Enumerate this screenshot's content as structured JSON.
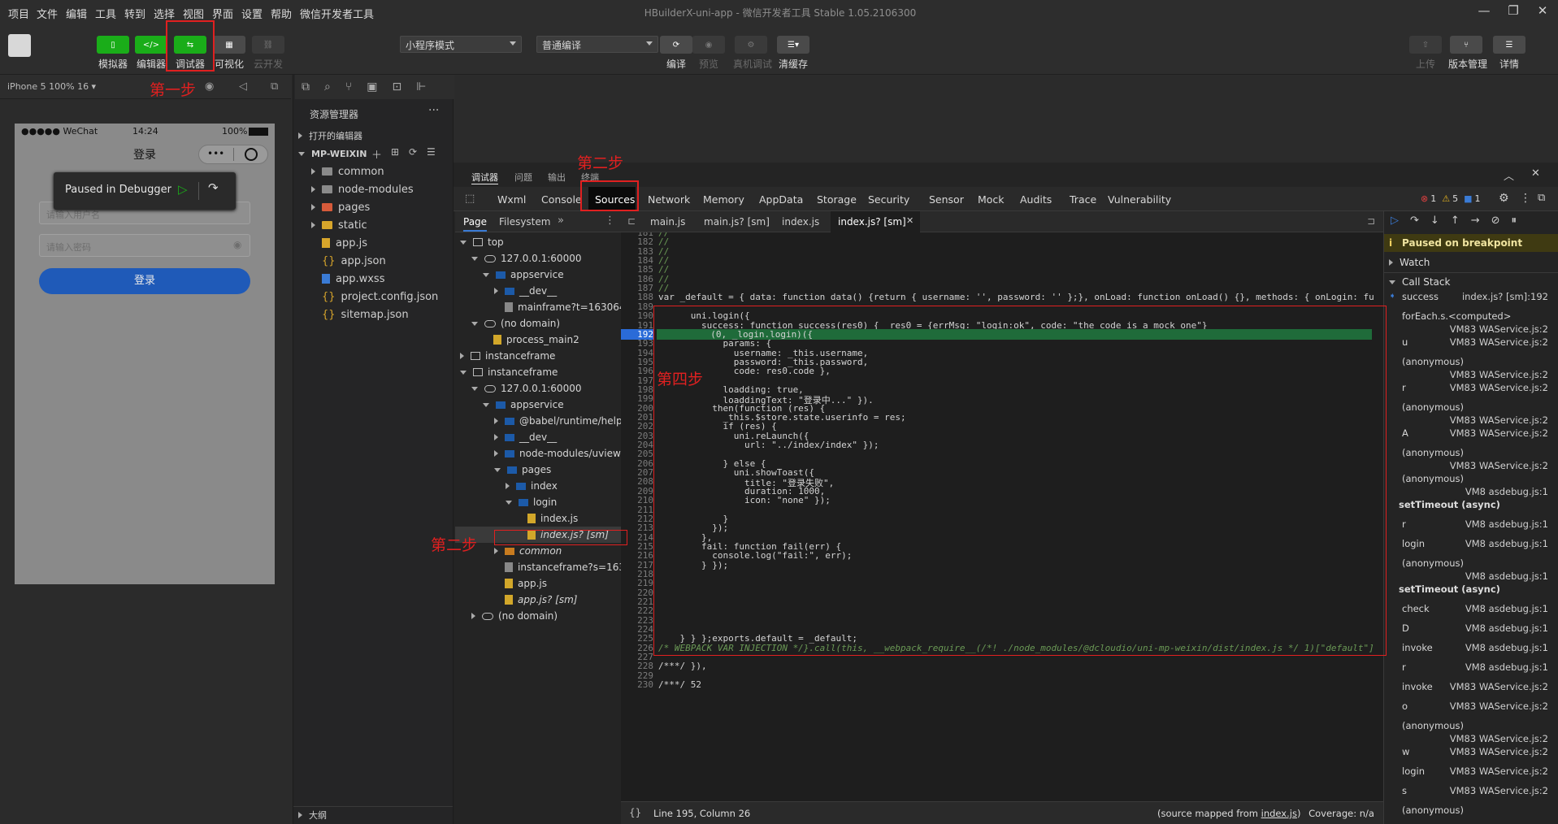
{
  "menu": [
    "项目",
    "文件",
    "编辑",
    "工具",
    "转到",
    "选择",
    "视图",
    "界面",
    "设置",
    "帮助",
    "微信开发者工具"
  ],
  "window_title": "HBuilderX-uni-app - 微信开发者工具 Stable 1.05.2106300",
  "toolbar": {
    "simulator": "模拟器",
    "editor": "编辑器",
    "debugger": "调试器",
    "visual": "可视化",
    "cloud": "云开发",
    "mode_select": "小程序模式",
    "compile_select": "普通编译",
    "compile": "编译",
    "preview": "预览",
    "remote_debug": "真机调试",
    "clear_cache": "清缓存",
    "upload": "上传",
    "version": "版本管理",
    "details": "详情"
  },
  "annotations": {
    "step1": "第一步",
    "step2a": "第二步",
    "step2b": "第二步",
    "step4": "第四步"
  },
  "device": {
    "info": "iPhone 5 100% 16 ▾",
    "carrier": "●●●●● WeChat",
    "time": "14:24",
    "battery": "100%",
    "page_title": "登录",
    "paused_text": "Paused in Debugger",
    "username_placeholder": "请输入用户名",
    "password_placeholder": "请输入密码",
    "login_button": "登录"
  },
  "explorer": {
    "title": "资源管理器",
    "open_editors": "打开的编辑器",
    "project": "MP-WEIXIN",
    "items": [
      "common",
      "node-modules",
      "pages",
      "static",
      "app.js",
      "app.json",
      "app.wxss",
      "project.config.json",
      "sitemap.json"
    ],
    "outline": "大纲"
  },
  "devtools": {
    "top_tabs": [
      "调试器",
      "问题",
      "输出",
      "终端"
    ],
    "tabs": [
      "Wxml",
      "Console",
      "Sources",
      "Network",
      "Memory",
      "AppData",
      "Storage",
      "Security",
      "Sensor",
      "Mock",
      "Audits",
      "Trace",
      "Vulnerability"
    ],
    "errors": "1",
    "warnings": "5",
    "infos": "1"
  },
  "sources": {
    "tabs": [
      "Page",
      "Filesystem"
    ],
    "tree": [
      {
        "label": "top",
        "depth": 0,
        "icon": "frame",
        "open": true
      },
      {
        "label": "127.0.0.1:60000",
        "depth": 1,
        "icon": "cloud",
        "open": true
      },
      {
        "label": "appservice",
        "depth": 2,
        "icon": "bfold",
        "open": true
      },
      {
        "label": "__dev__",
        "depth": 3,
        "icon": "bfold",
        "open": false
      },
      {
        "label": "mainframe?t=163064979",
        "depth": 3,
        "icon": "gfile",
        "open": null
      },
      {
        "label": "(no domain)",
        "depth": 1,
        "icon": "cloud",
        "open": true
      },
      {
        "label": "process_main2",
        "depth": 2,
        "icon": "yfile",
        "open": null
      },
      {
        "label": "instanceframe",
        "depth": 0,
        "icon": "frame",
        "open": false
      },
      {
        "label": "instanceframe",
        "depth": 0,
        "icon": "frame",
        "open": true
      },
      {
        "label": "127.0.0.1:60000",
        "depth": 1,
        "icon": "cloud",
        "open": true
      },
      {
        "label": "appservice",
        "depth": 2,
        "icon": "bfold",
        "open": true
      },
      {
        "label": "@babel/runtime/helpe",
        "depth": 3,
        "icon": "bfold",
        "open": false
      },
      {
        "label": "__dev__",
        "depth": 3,
        "icon": "bfold",
        "open": false
      },
      {
        "label": "node-modules/uview-",
        "depth": 3,
        "icon": "bfold",
        "open": false
      },
      {
        "label": "pages",
        "depth": 3,
        "icon": "bfold",
        "open": true
      },
      {
        "label": "index",
        "depth": 4,
        "icon": "bfold",
        "open": false
      },
      {
        "label": "login",
        "depth": 4,
        "icon": "bfold",
        "open": true
      },
      {
        "label": "index.js",
        "depth": 5,
        "icon": "yfile",
        "open": null
      },
      {
        "label": "index.js? [sm]",
        "depth": 5,
        "icon": "yfile",
        "open": null,
        "italic": true,
        "selected": true
      },
      {
        "label": "common",
        "depth": 3,
        "icon": "ofold",
        "open": false,
        "italic": true
      },
      {
        "label": "instanceframe?s=1630",
        "depth": 3,
        "icon": "gfile",
        "open": null
      },
      {
        "label": "app.js",
        "depth": 3,
        "icon": "yfile",
        "open": null
      },
      {
        "label": "app.js? [sm]",
        "depth": 3,
        "icon": "yfile",
        "open": null,
        "italic": true
      },
      {
        "label": "(no domain)",
        "depth": 1,
        "icon": "cloud",
        "open": false
      }
    ]
  },
  "editor": {
    "tabs": [
      "main.js",
      "main.js? [sm]",
      "index.js",
      "index.js? [sm]"
    ],
    "lines": [
      {
        "n": "181",
        "t": "//",
        "c": "cm"
      },
      {
        "n": "182",
        "t": "//",
        "c": "cm"
      },
      {
        "n": "183",
        "t": "//",
        "c": "cm"
      },
      {
        "n": "184",
        "t": "//",
        "c": "cm"
      },
      {
        "n": "185",
        "t": "//",
        "c": "cm"
      },
      {
        "n": "186",
        "t": "//",
        "c": "cm"
      },
      {
        "n": "187",
        "t": "//",
        "c": "cm"
      },
      {
        "n": "188",
        "t": "var _default = { data: function data() {return { username: '', password: '' };}, onLoad: function onLoad() {}, methods: { onLogin: fu",
        "c": ""
      },
      {
        "n": "189",
        "t": "",
        "c": ""
      },
      {
        "n": "190",
        "t": "      uni.login({",
        "c": ""
      },
      {
        "n": "191",
        "t": "        success: function success(res0) {  res0 = {errMsg: \"login:ok\", code: \"the code is a mock one\"}",
        "c": ""
      },
      {
        "n": "192",
        "t": "          (0, _login.login)({",
        "c": ""
      },
      {
        "n": "193",
        "t": "            params: {",
        "c": ""
      },
      {
        "n": "194",
        "t": "              username: _this.username,",
        "c": ""
      },
      {
        "n": "195",
        "t": "              password: _this.password,",
        "c": ""
      },
      {
        "n": "196",
        "t": "              code: res0.code },",
        "c": ""
      },
      {
        "n": "197",
        "t": "",
        "c": ""
      },
      {
        "n": "198",
        "t": "            loadding: true,",
        "c": ""
      },
      {
        "n": "199",
        "t": "            loaddingText: \"登录中...\" }).",
        "c": ""
      },
      {
        "n": "200",
        "t": "          then(function (res) {",
        "c": ""
      },
      {
        "n": "201",
        "t": "            _this.$store.state.userinfo = res;",
        "c": ""
      },
      {
        "n": "202",
        "t": "            if (res) {",
        "c": ""
      },
      {
        "n": "203",
        "t": "              uni.reLaunch({",
        "c": ""
      },
      {
        "n": "204",
        "t": "                url: \"../index/index\" });",
        "c": ""
      },
      {
        "n": "205",
        "t": "",
        "c": ""
      },
      {
        "n": "206",
        "t": "            } else {",
        "c": ""
      },
      {
        "n": "207",
        "t": "              uni.showToast({",
        "c": ""
      },
      {
        "n": "208",
        "t": "                title: \"登录失败\",",
        "c": ""
      },
      {
        "n": "209",
        "t": "                duration: 1000,",
        "c": ""
      },
      {
        "n": "210",
        "t": "                icon: \"none\" });",
        "c": ""
      },
      {
        "n": "211",
        "t": "",
        "c": ""
      },
      {
        "n": "212",
        "t": "            }",
        "c": ""
      },
      {
        "n": "213",
        "t": "          });",
        "c": ""
      },
      {
        "n": "214",
        "t": "        },",
        "c": ""
      },
      {
        "n": "215",
        "t": "        fail: function fail(err) {",
        "c": ""
      },
      {
        "n": "216",
        "t": "          console.log(\"fail:\", err);",
        "c": ""
      },
      {
        "n": "217",
        "t": "        } });",
        "c": ""
      },
      {
        "n": "218",
        "t": "",
        "c": ""
      },
      {
        "n": "219",
        "t": "",
        "c": ""
      },
      {
        "n": "220",
        "t": "",
        "c": ""
      },
      {
        "n": "221",
        "t": "",
        "c": ""
      },
      {
        "n": "222",
        "t": "",
        "c": ""
      },
      {
        "n": "223",
        "t": "",
        "c": ""
      },
      {
        "n": "224",
        "t": "",
        "c": ""
      },
      {
        "n": "225",
        "t": "    } } };exports.default = _default;",
        "c": ""
      },
      {
        "n": "226",
        "t": "/* WEBPACK VAR INJECTION */}.call(this, __webpack_require__(/*! ./node_modules/@dcloudio/uni-mp-weixin/dist/index.js */ 1)[\"default\"]",
        "c": ""
      },
      {
        "n": "227",
        "t": "",
        "c": ""
      },
      {
        "n": "228",
        "t": "/***/ }),",
        "c": ""
      },
      {
        "n": "229",
        "t": "",
        "c": ""
      },
      {
        "n": "230",
        "t": "/***/ 52",
        "c": ""
      }
    ],
    "status": "Line 195, Column 26",
    "source_mapped_prefix": "(source mapped from",
    "source_mapped_file": "index.js",
    "source_mapped_suffix": ")",
    "coverage": "Coverage: n/a"
  },
  "debugger": {
    "paused": "Paused on breakpoint",
    "watch": "Watch",
    "call_stack": "Call Stack",
    "frames": [
      {
        "fn": "success",
        "loc": "index.js? [sm]:192",
        "active": true,
        "wrap": false
      },
      {
        "fn": "forEach.s.<computed>",
        "loc": "VM83 WAService.js:2",
        "wrap": true
      },
      {
        "fn": "u",
        "loc": "VM83 WAService.js:2",
        "wrap": false
      },
      {
        "fn": "(anonymous)",
        "loc": "VM83 WAService.js:2",
        "wrap": true
      },
      {
        "fn": "r",
        "loc": "VM83 WAService.js:2",
        "wrap": false
      },
      {
        "fn": "(anonymous)",
        "loc": "VM83 WAService.js:2",
        "wrap": true
      },
      {
        "fn": "A",
        "loc": "VM83 WAService.js:2",
        "wrap": false
      },
      {
        "fn": "(anonymous)",
        "loc": "VM83 WAService.js:2",
        "wrap": true
      },
      {
        "fn": "(anonymous)",
        "loc": "VM8 asdebug.js:1",
        "wrap": true
      },
      {
        "fn": "setTimeout (async)",
        "loc": "",
        "async": true
      },
      {
        "fn": "r",
        "loc": "VM8 asdebug.js:1",
        "wrap": false
      },
      {
        "fn": "login",
        "loc": "VM8 asdebug.js:1",
        "wrap": false
      },
      {
        "fn": "(anonymous)",
        "loc": "VM8 asdebug.js:1",
        "wrap": true
      },
      {
        "fn": "setTimeout (async)",
        "loc": "",
        "async": true
      },
      {
        "fn": "check",
        "loc": "VM8 asdebug.js:1",
        "wrap": false
      },
      {
        "fn": "D",
        "loc": "VM8 asdebug.js:1",
        "wrap": false
      },
      {
        "fn": "invoke",
        "loc": "VM8 asdebug.js:1",
        "wrap": false
      },
      {
        "fn": "r",
        "loc": "VM8 asdebug.js:1",
        "wrap": false
      },
      {
        "fn": "invoke",
        "loc": "VM83 WAService.js:2",
        "wrap": false
      },
      {
        "fn": "o",
        "loc": "VM83 WAService.js:2",
        "wrap": false
      },
      {
        "fn": "(anonymous)",
        "loc": "VM83 WAService.js:2",
        "wrap": true
      },
      {
        "fn": "w",
        "loc": "VM83 WAService.js:2",
        "wrap": false
      },
      {
        "fn": "login",
        "loc": "VM83 WAService.js:2",
        "wrap": false
      },
      {
        "fn": "s",
        "loc": "VM83 WAService.js:2",
        "wrap": false
      },
      {
        "fn": "(anonymous)",
        "loc": "",
        "wrap": false
      }
    ]
  }
}
